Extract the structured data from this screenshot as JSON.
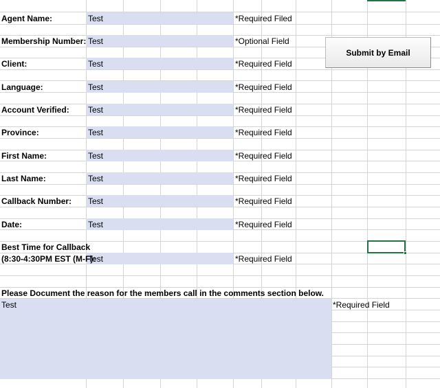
{
  "form": {
    "rows": [
      {
        "label": "Agent Name:",
        "value": "Test",
        "note": "*Required Filed"
      },
      {
        "label": "Membership Number:",
        "value": "Test",
        "note": "*Optional Field"
      },
      {
        "label": "Client:",
        "value": "Test",
        "note": "*Required Field"
      },
      {
        "label": "Language:",
        "value": "Test",
        "note": "*Required Field"
      },
      {
        "label": "Account Verified:",
        "value": "Test",
        "note": "*Required Field"
      },
      {
        "label": "Province:",
        "value": "Test",
        "note": "*Required Field"
      },
      {
        "label": "First Name:",
        "value": "Test",
        "note": "*Required Field"
      },
      {
        "label": "Last Name:",
        "value": "Test",
        "note": "*Required Field"
      },
      {
        "label": "Callback Number:",
        "value": "Test",
        "note": "*Required Field"
      },
      {
        "label": "Date:",
        "value": "Test",
        "note": "*Required Field"
      }
    ],
    "callback": {
      "label_line1": "Best Time for Callback",
      "label_line2": "(8:30-4:30PM EST (M-F):",
      "value": "Test",
      "note": "*Required Field"
    },
    "comments": {
      "instruction": "Please Document the reason for the members call in the comments section below.",
      "value": "Test",
      "note": "*Required Field"
    }
  },
  "submit_button": {
    "label": "Submit by Email"
  },
  "colors": {
    "input_fill": "#d9dff1",
    "gridline": "#d4d4d4",
    "selection": "#217346"
  }
}
